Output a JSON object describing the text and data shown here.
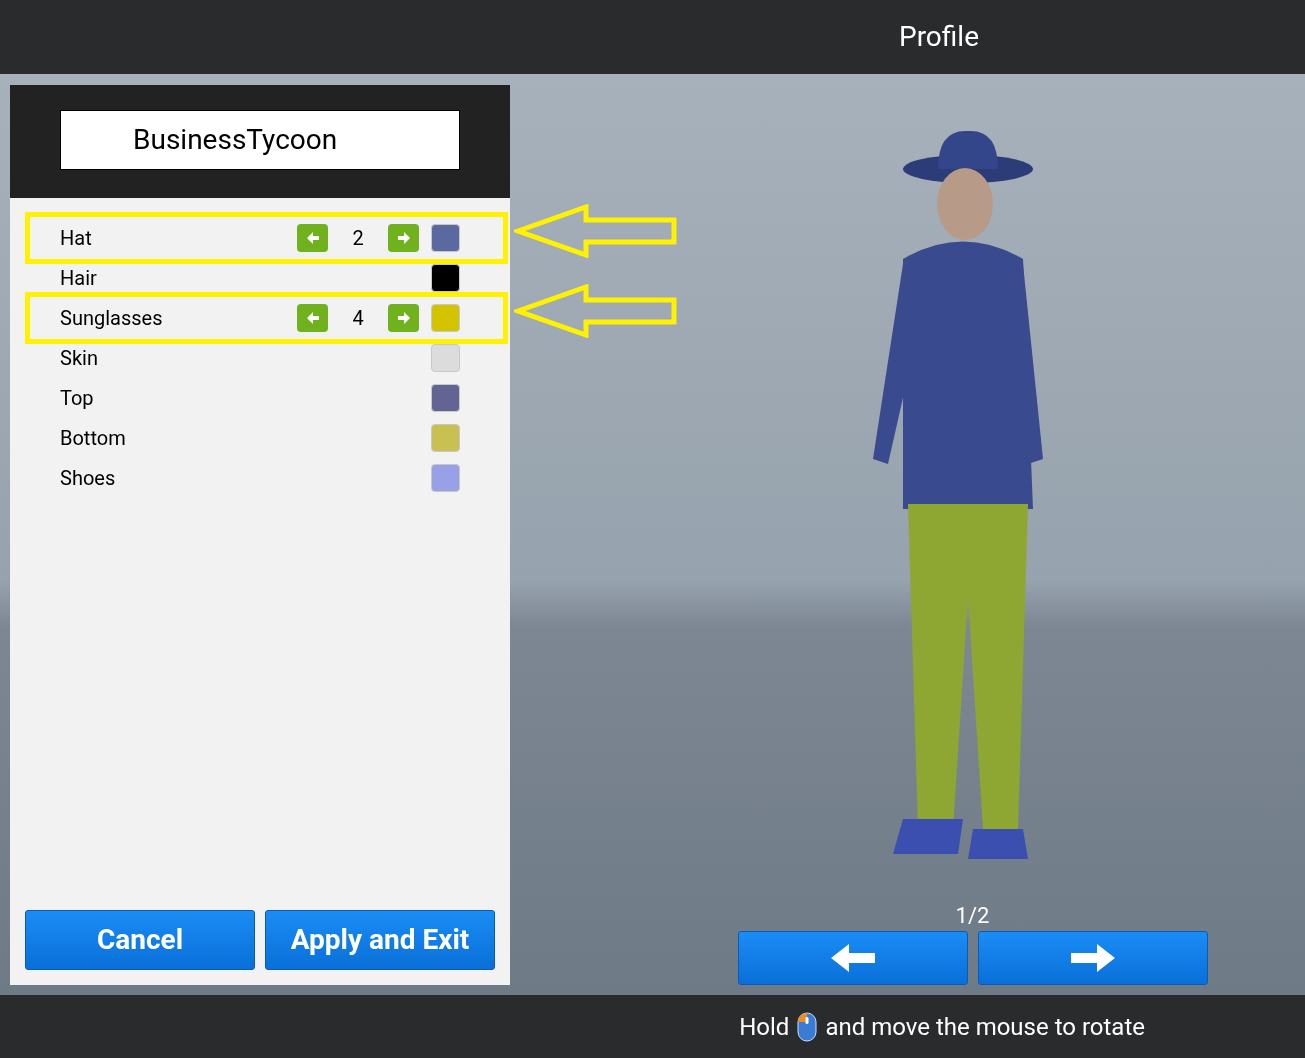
{
  "header": {
    "title": "Profile"
  },
  "name_field": {
    "value": "BusinessTycoon"
  },
  "options": [
    {
      "label": "Hat",
      "kind": "stepper",
      "value": "2",
      "color": "#5a6aa0",
      "highlighted": true
    },
    {
      "label": "Hair",
      "kind": "plain",
      "color": "#000000",
      "highlighted": false
    },
    {
      "label": "Sunglasses",
      "kind": "stepper",
      "value": "4",
      "color": "#d4c400",
      "highlighted": true
    },
    {
      "label": "Skin",
      "kind": "plain",
      "color": "#dcdcdc",
      "highlighted": false
    },
    {
      "label": "Top",
      "kind": "plain",
      "color": "#646494",
      "highlighted": false
    },
    {
      "label": "Bottom",
      "kind": "plain",
      "color": "#c8c050",
      "highlighted": false
    },
    {
      "label": "Shoes",
      "kind": "plain",
      "color": "#98a0e8",
      "highlighted": false
    }
  ],
  "actions": [
    "Cancel",
    "Apply and Exit"
  ],
  "pager": {
    "text": "1/2"
  },
  "hint": {
    "before": "Hold",
    "after": "and move the mouse to rotate"
  }
}
